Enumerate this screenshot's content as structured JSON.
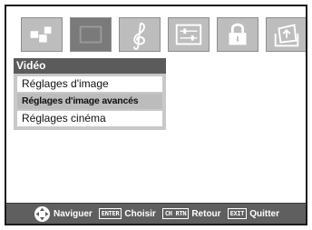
{
  "tabs": [
    {
      "name": "settings-tab",
      "icon": "puzzle-pieces-icon",
      "active": false
    },
    {
      "name": "picture-tab",
      "icon": "picture-screen-icon",
      "active": true
    },
    {
      "name": "audio-tab",
      "icon": "treble-clef-icon",
      "active": false
    },
    {
      "name": "preferences-tab",
      "icon": "slider-panel-icon",
      "active": false
    },
    {
      "name": "locks-tab",
      "icon": "padlock-icon",
      "active": false
    },
    {
      "name": "setup-tab",
      "icon": "setup-tray-icon",
      "active": false
    }
  ],
  "menu": {
    "title": "Vidéo",
    "items": [
      {
        "label": "Réglages d'image",
        "selected": false
      },
      {
        "label": "Réglages d'image avancés",
        "selected": true
      },
      {
        "label": "Réglages cinéma",
        "selected": false
      }
    ]
  },
  "footer": {
    "navigate_icon": "directional-pad-icon",
    "navigate_label": "Naviguer",
    "enter_key": "ENTER",
    "enter_label": "Choisir",
    "return_key": "CH RTN",
    "return_label": "Retour",
    "exit_key": "EXIT",
    "exit_label": "Quitter"
  }
}
